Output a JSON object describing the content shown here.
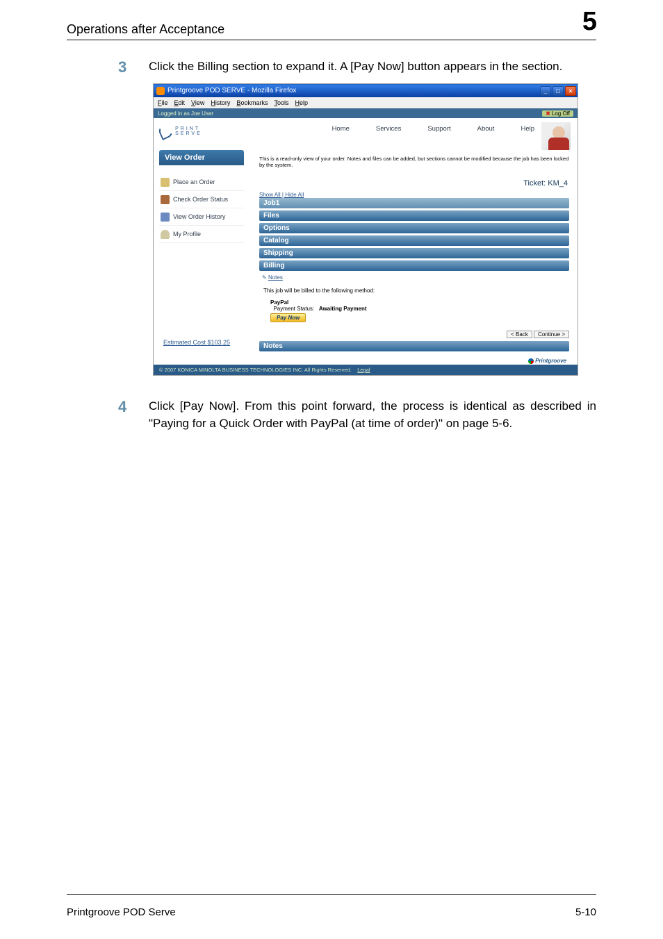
{
  "header": {
    "title": "Operations after Acceptance",
    "chapter": "5"
  },
  "steps": {
    "s3_num": "3",
    "s3_text": "Click the Billing section to expand it. A [Pay Now] button appears in the section.",
    "s4_num": "4",
    "s4_text": "Click [Pay Now]. From this point forward, the process is identical as described in \"Paying for a Quick Order with PayPal (at time of order)\" on page 5-6."
  },
  "app": {
    "titlebar": "Printgroove POD SERVE - Mozilla Firefox",
    "menu": {
      "file": "File",
      "edit": "Edit",
      "view": "View",
      "history": "History",
      "bookmarks": "Bookmarks",
      "tools": "Tools",
      "help": "Help"
    },
    "logged_in": "Logged in as Joe User",
    "logoff": "Log Off",
    "nav": {
      "home": "Home",
      "services": "Services",
      "support": "Support",
      "about": "About",
      "help": "Help"
    },
    "logo_text": "PRINT\nSERVE",
    "view_order": "View Order",
    "side": {
      "place": "Place an Order",
      "check": "Check Order Status",
      "history": "View Order History",
      "profile": "My Profile"
    },
    "estimated": "Estimated Cost $103.25",
    "readonly": "This is a read-only view of your order. Notes and files can be added, but sections cannot be modified because the job has been locked by the system.",
    "ticket": "Ticket: KM_4",
    "showhide": "Show All | Hide All",
    "sections": {
      "job": "Job1",
      "files": "Files",
      "options": "Options",
      "catalog": "Catalog",
      "shipping": "Shipping",
      "billing": "Billing",
      "notes_link": "Notes",
      "billing_text": "This job will be billed to the following method:",
      "paypal": "PayPal",
      "payment_status_label": "Payment Status:",
      "payment_status_value": "Awaiting Payment",
      "paynow": "Pay Now",
      "notes": "Notes"
    },
    "buttons": {
      "back": "< Back",
      "continue": "Continue >"
    },
    "copyright": "© 2007 KONICA MINOLTA BUSINESS TECHNOLOGIES INC. All Rights Reserved.",
    "legal": "Legal",
    "pg_logo": "Printgroove"
  },
  "footer": {
    "product": "Printgroove POD Serve",
    "page": "5-10"
  }
}
